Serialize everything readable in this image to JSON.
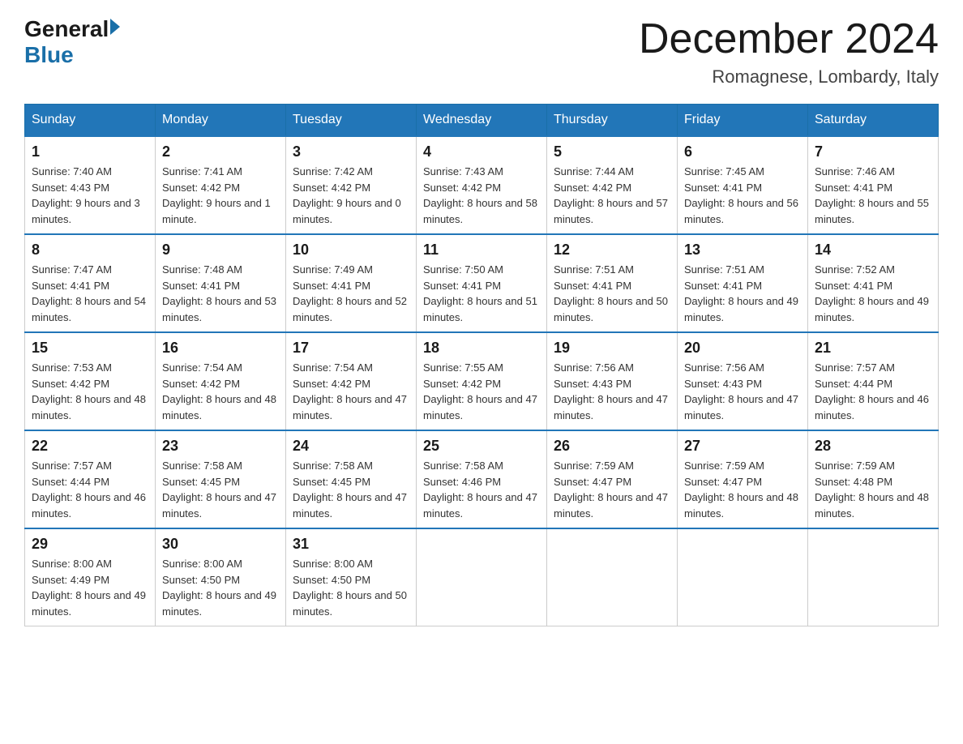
{
  "header": {
    "logo_general": "General",
    "logo_blue": "Blue",
    "month_title": "December 2024",
    "location": "Romagnese, Lombardy, Italy"
  },
  "days_of_week": [
    "Sunday",
    "Monday",
    "Tuesday",
    "Wednesday",
    "Thursday",
    "Friday",
    "Saturday"
  ],
  "weeks": [
    [
      {
        "day": "1",
        "sunrise": "7:40 AM",
        "sunset": "4:43 PM",
        "daylight": "9 hours and 3 minutes."
      },
      {
        "day": "2",
        "sunrise": "7:41 AM",
        "sunset": "4:42 PM",
        "daylight": "9 hours and 1 minute."
      },
      {
        "day": "3",
        "sunrise": "7:42 AM",
        "sunset": "4:42 PM",
        "daylight": "9 hours and 0 minutes."
      },
      {
        "day": "4",
        "sunrise": "7:43 AM",
        "sunset": "4:42 PM",
        "daylight": "8 hours and 58 minutes."
      },
      {
        "day": "5",
        "sunrise": "7:44 AM",
        "sunset": "4:42 PM",
        "daylight": "8 hours and 57 minutes."
      },
      {
        "day": "6",
        "sunrise": "7:45 AM",
        "sunset": "4:41 PM",
        "daylight": "8 hours and 56 minutes."
      },
      {
        "day": "7",
        "sunrise": "7:46 AM",
        "sunset": "4:41 PM",
        "daylight": "8 hours and 55 minutes."
      }
    ],
    [
      {
        "day": "8",
        "sunrise": "7:47 AM",
        "sunset": "4:41 PM",
        "daylight": "8 hours and 54 minutes."
      },
      {
        "day": "9",
        "sunrise": "7:48 AM",
        "sunset": "4:41 PM",
        "daylight": "8 hours and 53 minutes."
      },
      {
        "day": "10",
        "sunrise": "7:49 AM",
        "sunset": "4:41 PM",
        "daylight": "8 hours and 52 minutes."
      },
      {
        "day": "11",
        "sunrise": "7:50 AM",
        "sunset": "4:41 PM",
        "daylight": "8 hours and 51 minutes."
      },
      {
        "day": "12",
        "sunrise": "7:51 AM",
        "sunset": "4:41 PM",
        "daylight": "8 hours and 50 minutes."
      },
      {
        "day": "13",
        "sunrise": "7:51 AM",
        "sunset": "4:41 PM",
        "daylight": "8 hours and 49 minutes."
      },
      {
        "day": "14",
        "sunrise": "7:52 AM",
        "sunset": "4:41 PM",
        "daylight": "8 hours and 49 minutes."
      }
    ],
    [
      {
        "day": "15",
        "sunrise": "7:53 AM",
        "sunset": "4:42 PM",
        "daylight": "8 hours and 48 minutes."
      },
      {
        "day": "16",
        "sunrise": "7:54 AM",
        "sunset": "4:42 PM",
        "daylight": "8 hours and 48 minutes."
      },
      {
        "day": "17",
        "sunrise": "7:54 AM",
        "sunset": "4:42 PM",
        "daylight": "8 hours and 47 minutes."
      },
      {
        "day": "18",
        "sunrise": "7:55 AM",
        "sunset": "4:42 PM",
        "daylight": "8 hours and 47 minutes."
      },
      {
        "day": "19",
        "sunrise": "7:56 AM",
        "sunset": "4:43 PM",
        "daylight": "8 hours and 47 minutes."
      },
      {
        "day": "20",
        "sunrise": "7:56 AM",
        "sunset": "4:43 PM",
        "daylight": "8 hours and 47 minutes."
      },
      {
        "day": "21",
        "sunrise": "7:57 AM",
        "sunset": "4:44 PM",
        "daylight": "8 hours and 46 minutes."
      }
    ],
    [
      {
        "day": "22",
        "sunrise": "7:57 AM",
        "sunset": "4:44 PM",
        "daylight": "8 hours and 46 minutes."
      },
      {
        "day": "23",
        "sunrise": "7:58 AM",
        "sunset": "4:45 PM",
        "daylight": "8 hours and 47 minutes."
      },
      {
        "day": "24",
        "sunrise": "7:58 AM",
        "sunset": "4:45 PM",
        "daylight": "8 hours and 47 minutes."
      },
      {
        "day": "25",
        "sunrise": "7:58 AM",
        "sunset": "4:46 PM",
        "daylight": "8 hours and 47 minutes."
      },
      {
        "day": "26",
        "sunrise": "7:59 AM",
        "sunset": "4:47 PM",
        "daylight": "8 hours and 47 minutes."
      },
      {
        "day": "27",
        "sunrise": "7:59 AM",
        "sunset": "4:47 PM",
        "daylight": "8 hours and 48 minutes."
      },
      {
        "day": "28",
        "sunrise": "7:59 AM",
        "sunset": "4:48 PM",
        "daylight": "8 hours and 48 minutes."
      }
    ],
    [
      {
        "day": "29",
        "sunrise": "8:00 AM",
        "sunset": "4:49 PM",
        "daylight": "8 hours and 49 minutes."
      },
      {
        "day": "30",
        "sunrise": "8:00 AM",
        "sunset": "4:50 PM",
        "daylight": "8 hours and 49 minutes."
      },
      {
        "day": "31",
        "sunrise": "8:00 AM",
        "sunset": "4:50 PM",
        "daylight": "8 hours and 50 minutes."
      },
      null,
      null,
      null,
      null
    ]
  ]
}
